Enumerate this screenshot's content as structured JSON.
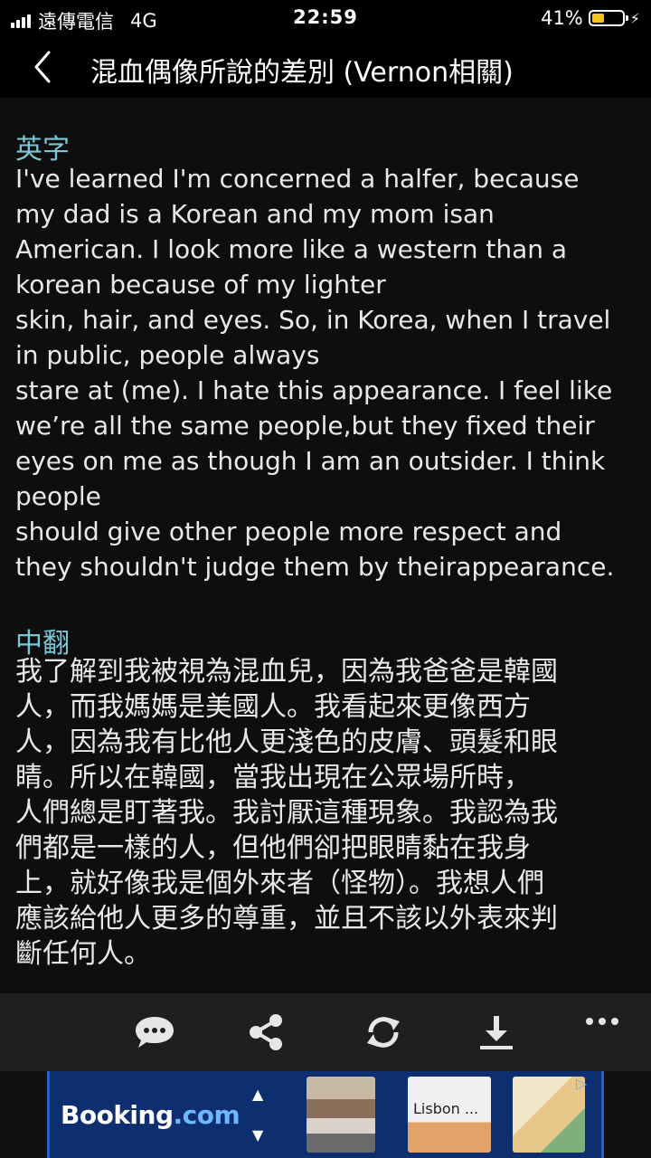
{
  "status_bar": {
    "carrier": "遠傳電信",
    "network": "4G",
    "time": "22:59",
    "battery_percent_label": "41%",
    "battery_level": 0.41,
    "battery_color": "#f5c518"
  },
  "nav": {
    "back_icon": "chevron-left-icon",
    "title": "混血偶像所說的差別 (Vernon相關)"
  },
  "article": {
    "english_heading": "英字",
    "english_lines": [
      "I've learned I'm concerned a halfer, because",
      "my dad is a Korean and my mom isan",
      "American. I look more like a western than a",
      "korean because of my lighter",
      "skin, hair, and eyes. So, in Korea, when I travel",
      "in public, people always",
      "stare at (me). I hate this appearance. I feel like",
      "we’re all the same people,but they fixed their",
      "eyes on me as though I am an outsider. I think",
      "people",
      "should give other people more respect and",
      "they shouldn't judge them by theirappearance."
    ],
    "chinese_heading": "中翻",
    "chinese_lines": [
      "我了解到我被視為混血兒，因為我爸爸是韓國",
      "人，而我媽媽是美國人。我看起來更像西方",
      "人，因為我有比他人更淺色的皮膚、頭髮和眼",
      "睛。所以在韓國，當我出現在公眾場所時，",
      "人們總是盯著我。我討厭這種現象。我認為我",
      "們都是一樣的人，但他們卻把眼睛黏在我身",
      "上，就好像我是個外來者（怪物）。我想人們",
      "應該給他人更多的尊重，並且不該以外表來判",
      "斷任何人。"
    ],
    "heading_color": "#7cc7d6"
  },
  "toolbar": {
    "buttons": [
      "comment-icon",
      "share-icon",
      "refresh-icon",
      "download-icon",
      "more-icon"
    ]
  },
  "ad": {
    "brand_main": "Booking",
    "brand_suffix": ".com",
    "thumb_label": "Lisbon ...",
    "brand_color": "#0e2f6f"
  }
}
